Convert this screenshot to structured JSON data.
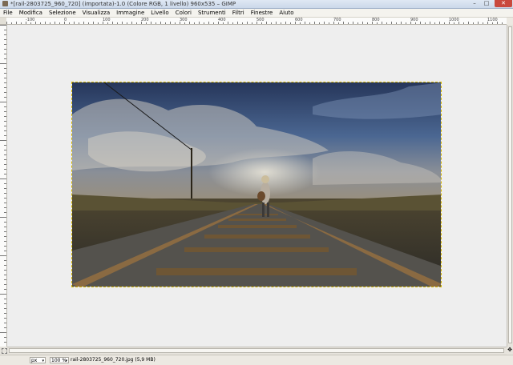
{
  "window": {
    "title": "*[rail-2803725_960_720] (importata)-1.0 (Colore RGB, 1 livello) 960x535 – GIMP",
    "minimize_glyph": "–",
    "maximize_glyph": "□",
    "close_glyph": "✕"
  },
  "menu": [
    {
      "label": "File"
    },
    {
      "label": "Modifica"
    },
    {
      "label": "Selezione"
    },
    {
      "label": "Visualizza"
    },
    {
      "label": "Immagine"
    },
    {
      "label": "Livello"
    },
    {
      "label": "Colori"
    },
    {
      "label": "Strumenti"
    },
    {
      "label": "Filtri"
    },
    {
      "label": "Finestre"
    },
    {
      "label": "Aiuto"
    }
  ],
  "ruler": {
    "top_labels": [
      "-100",
      "0",
      "100",
      "200",
      "300",
      "400",
      "500",
      "600",
      "700",
      "800",
      "900",
      "1000",
      "1100"
    ]
  },
  "image": {
    "description_icon": "image-canvas",
    "colors": {
      "sky": "#3e5a8a",
      "ground": "#4a4130",
      "rail": "#8a6a42",
      "selection": "#d6b600"
    }
  },
  "statusbar": {
    "unit": "px",
    "zoom": "100 %",
    "file_info": "rail-2803725_960_720.jpg (5,9 MB)"
  }
}
